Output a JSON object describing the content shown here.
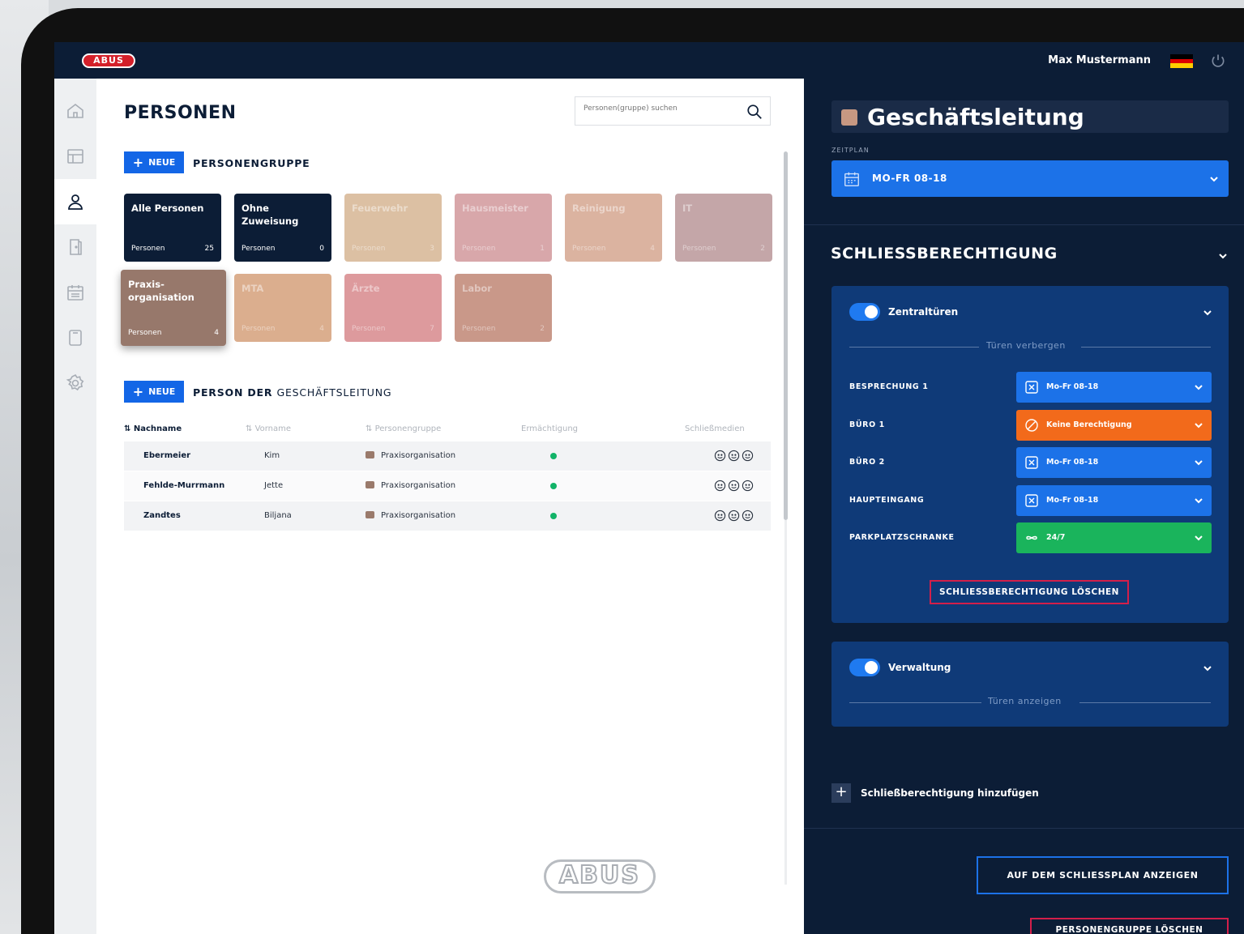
{
  "header": {
    "logo": "ABUS",
    "user_name": "Max Mustermann",
    "flag_colors": [
      "#000000",
      "#dd0000",
      "#ffce00"
    ]
  },
  "rail": {
    "items": [
      "home-icon",
      "dashboard-icon",
      "person-icon",
      "door-icon",
      "calendar-icon",
      "tablet-icon",
      "gear-icon"
    ],
    "active": 2
  },
  "main": {
    "title": "PERSONEN",
    "search_placeholder": "Personen(gruppe) suchen",
    "new_label": "NEUE",
    "group_section": "PERSONENGRUPPE",
    "groups": [
      {
        "name": "Alle Personen",
        "sub": "Personen",
        "count": "25",
        "color": "#0c1d36",
        "dim": false
      },
      {
        "name": "Ohne Zuweisung",
        "sub": "Personen",
        "count": "0",
        "color": "#0c1d36",
        "dim": false
      },
      {
        "name": "Feuerwehr",
        "sub": "Personen",
        "count": "3",
        "color": "#dcc0a3",
        "dim": true
      },
      {
        "name": "Hausmeister",
        "sub": "Personen",
        "count": "1",
        "color": "#d8a7aa",
        "dim": true
      },
      {
        "name": "Reinigung",
        "sub": "Personen",
        "count": "4",
        "color": "#dbb3a0",
        "dim": true
      },
      {
        "name": "IT",
        "sub": "Personen",
        "count": "2",
        "color": "#c4a6a8",
        "dim": true
      },
      {
        "name": "Praxis-organisation",
        "sub": "Personen",
        "count": "4",
        "color": "#97786b",
        "dim": false
      },
      {
        "name": "MTA",
        "sub": "Personen",
        "count": "4",
        "color": "#dbae8e",
        "dim": true
      },
      {
        "name": "Ärzte",
        "sub": "Personen",
        "count": "7",
        "color": "#dd9a9d",
        "dim": true
      },
      {
        "name": "Labor",
        "sub": "Personen",
        "count": "2",
        "color": "#c99889",
        "dim": true
      }
    ],
    "person_section_bold": "PERSON DER",
    "person_section_rest": "GESCHÄFTSLEITUNG",
    "columns": [
      "Nachname",
      "Vorname",
      "Personengruppe",
      "Ermächtigung",
      "Schließmedien"
    ],
    "rows": [
      {
        "last": "Ebermeier",
        "first": "Kim",
        "group": "Praxisorganisation"
      },
      {
        "last": "Fehlde-Murrmann",
        "first": "Jette",
        "group": "Praxisorganisation"
      },
      {
        "last": "Zandtes",
        "first": "Biljana",
        "group": "Praxisorganisation"
      }
    ],
    "watermark": "ABUS"
  },
  "right": {
    "group_name": "Geschäftsleitung",
    "schedule_label": "ZEITPLAN",
    "schedule_value": "MO-FR 08-18",
    "section_title": "SCHLIESSBERECHTIGUNG",
    "card1": {
      "name": "Zentraltüren",
      "toggle_text": "Türen verbergen",
      "doors": [
        {
          "label": "BESPRECHUNG 1",
          "value": "Mo-Fr 08-18",
          "kind": "blue"
        },
        {
          "label": "BÜRO 1",
          "value": "Keine Berechtigung",
          "kind": "orange"
        },
        {
          "label": "BÜRO 2",
          "value": "Mo-Fr 08-18",
          "kind": "blue"
        },
        {
          "label": "HAUPTEINGANG",
          "value": "Mo-Fr 08-18",
          "kind": "blue"
        },
        {
          "label": "PARKPLATZSCHRANKE",
          "value": "24/7",
          "kind": "green"
        }
      ],
      "delete_label": "SCHLIESSBERECHTIGUNG LÖSCHEN"
    },
    "card2": {
      "name": "Verwaltung",
      "toggle_text": "Türen anzeigen"
    },
    "add_label": "Schließberechtigung hinzufügen",
    "show_plan_label": "AUF DEM SCHLIESSPLAN ANZEIGEN",
    "delete_group_label": "PERSONENGRUPPE LÖSCHEN"
  }
}
